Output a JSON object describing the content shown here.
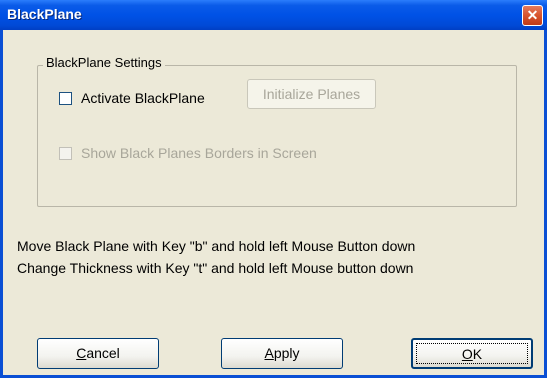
{
  "window": {
    "title": "BlackPlane",
    "close_glyph": "✕",
    "title_color": "#0052e6"
  },
  "group": {
    "label": "BlackPlane Settings",
    "activate": {
      "label": "Activate BlackPlane",
      "checked": false
    },
    "initialize_button": {
      "label": "Initialize Planes",
      "enabled": false
    },
    "show_borders": {
      "label": "Show Black Planes Borders in Screen",
      "checked": false,
      "enabled": false
    }
  },
  "info": {
    "line1": "Move Black Plane with Key \"b\" and hold left Mouse Button down",
    "line2": "Change Thickness with Key \"t\" and hold left Mouse button down"
  },
  "buttons": {
    "cancel": {
      "label": "Cancel",
      "mnemonic_index": 0
    },
    "apply": {
      "label": "Apply",
      "mnemonic_index": 0
    },
    "ok": {
      "label": "OK",
      "mnemonic_index": 0,
      "default": true
    }
  }
}
